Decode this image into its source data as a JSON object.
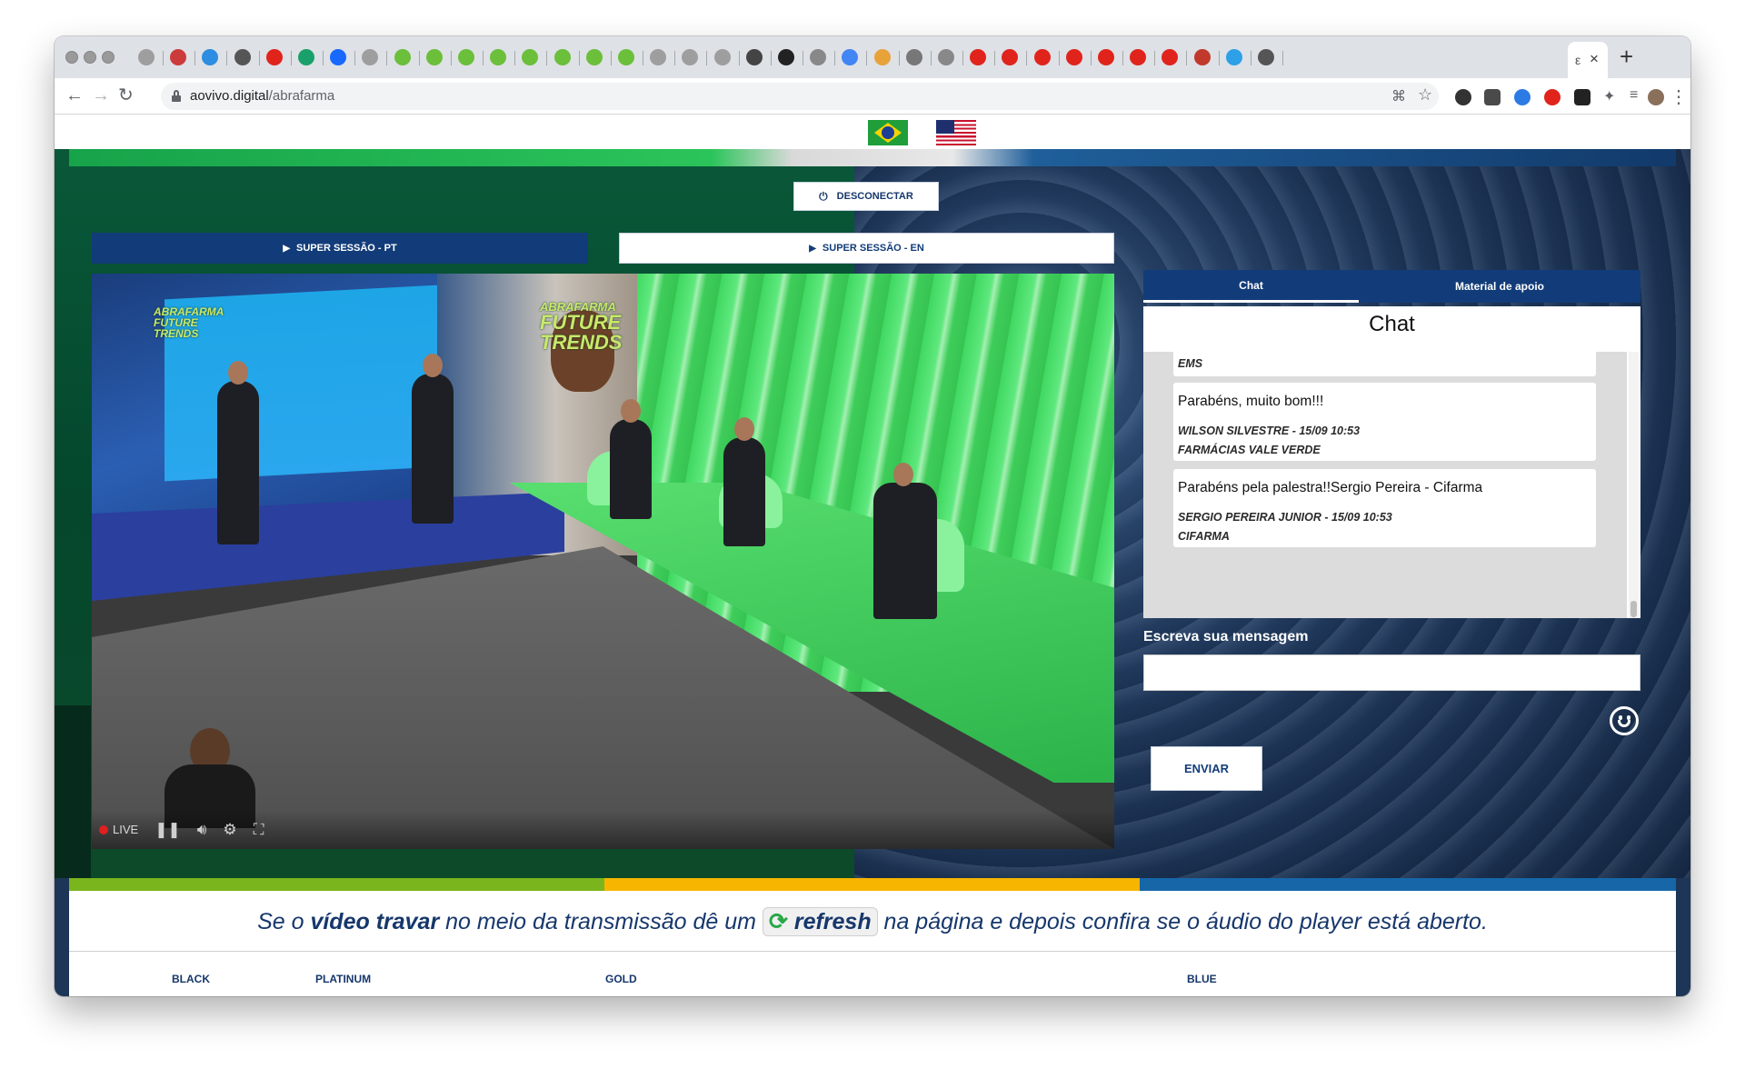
{
  "browser": {
    "url_domain": "aovivo.digital",
    "url_path": "/abrafarma"
  },
  "page": {
    "disconnect_label": "DESCONECTAR",
    "session_pt_label": "SUPER SESSÃO - PT",
    "session_en_label": "SUPER SESSÃO - EN",
    "video": {
      "logo_line1": "ABRAFARMA",
      "logo_line2": "FUTURE",
      "logo_line3": "TRENDS",
      "live_label": "LIVE"
    },
    "chat": {
      "tab_chat": "Chat",
      "tab_material": "Material de apoio",
      "title": "Chat",
      "messages": [
        {
          "text": "",
          "author": "",
          "company": "EMS"
        },
        {
          "text": "Parabéns, muito bom!!!",
          "author": "WILSON SILVESTRE - 15/09 10:53",
          "company": "FARMÁCIAS VALE VERDE"
        },
        {
          "text": "Parabéns pela palestra!!Sergio Pereira - Cifarma",
          "author": "SERGIO PEREIRA JUNIOR - 15/09 10:53",
          "company": "CIFARMA"
        }
      ],
      "input_label": "Escreva sua mensagem",
      "input_value": "",
      "send_label": "ENVIAR"
    },
    "notice": {
      "part1": "Se o ",
      "part2": "vídeo travar",
      "part3": " no meio da transmissão dê um ",
      "refresh": "refresh",
      "part4": " na página e depois confira se o áudio do player está aberto."
    },
    "tiers": [
      "BLACK",
      "PLATINUM",
      "GOLD",
      "BLUE"
    ]
  },
  "colors": {
    "brand_blue": "#123c79",
    "stripe_green": "#7ab51d",
    "stripe_yellow": "#f7b500",
    "stripe_blue": "#1666a8"
  }
}
